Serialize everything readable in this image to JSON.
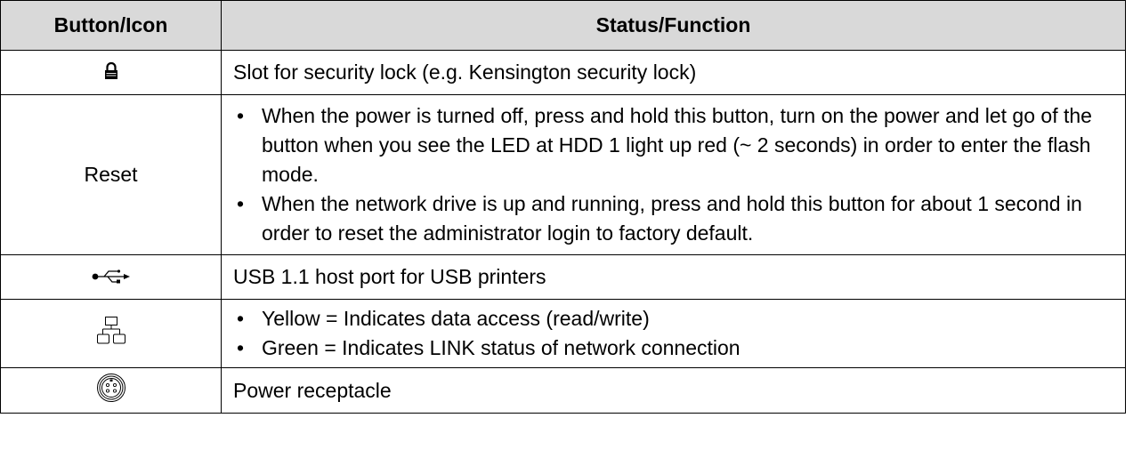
{
  "table": {
    "headers": [
      "Button/Icon",
      "Status/Function"
    ],
    "rows": [
      {
        "icon": "padlock-icon",
        "label": "",
        "text": "Slot for security lock (e.g. Kensington security lock)"
      },
      {
        "icon": "",
        "label": "Reset",
        "bullets": [
          "When the power is turned off, press and hold this button, turn on the power and let go of the button when you see the LED at HDD 1 light up red (~ 2 seconds) in order to enter the flash mode.",
          "When the network drive is up and running, press and hold this button for about 1 second in order to reset the administrator login to factory default."
        ]
      },
      {
        "icon": "usb-icon",
        "label": "",
        "text": "USB 1.1 host port for USB printers"
      },
      {
        "icon": "network-icon",
        "label": "",
        "bullets": [
          "Yellow = Indicates data access (read/write)",
          "Green = Indicates LINK status of network connection"
        ]
      },
      {
        "icon": "power-connector-icon",
        "label": "",
        "text": "Power receptacle"
      }
    ]
  }
}
